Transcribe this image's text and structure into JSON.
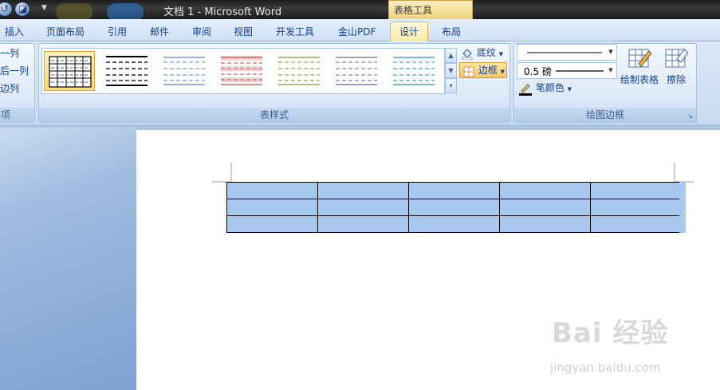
{
  "titlebar": {
    "document_title": "文档 1 - Microsoft Word",
    "context_tab_label": "表格工具"
  },
  "tabs": [
    {
      "label": "插入"
    },
    {
      "label": "页面布局"
    },
    {
      "label": "引用"
    },
    {
      "label": "邮件"
    },
    {
      "label": "审阅"
    },
    {
      "label": "视图"
    },
    {
      "label": "开发工具"
    },
    {
      "label": "金山PDF"
    },
    {
      "label": "设计"
    },
    {
      "label": "布局"
    }
  ],
  "active_tab": "设计",
  "left_group": {
    "items": [
      "一列",
      "后一列",
      "边列"
    ],
    "label": "项"
  },
  "table_styles": {
    "label": "表样式",
    "shading_label": "底纹",
    "borders_label": "边框"
  },
  "draw_borders": {
    "label": "绘图边框",
    "pen_weight": "0.5 磅",
    "pen_color_label": "笔颜色",
    "draw_table_label": "绘制表格",
    "eraser_label": "擦除"
  },
  "watermark": {
    "text": "Bai 经验",
    "sub_text": "jingyan.baidu.com"
  },
  "colors": {
    "ribbon_blue": "#15428b",
    "selection_blue": "#a8c8f0",
    "active_tab_gold": "#fbe9a9",
    "style_red": "#d98a8a",
    "style_green": "#a8b86a",
    "style_purple": "#9b8ac6",
    "style_teal": "#5fb0c0"
  }
}
